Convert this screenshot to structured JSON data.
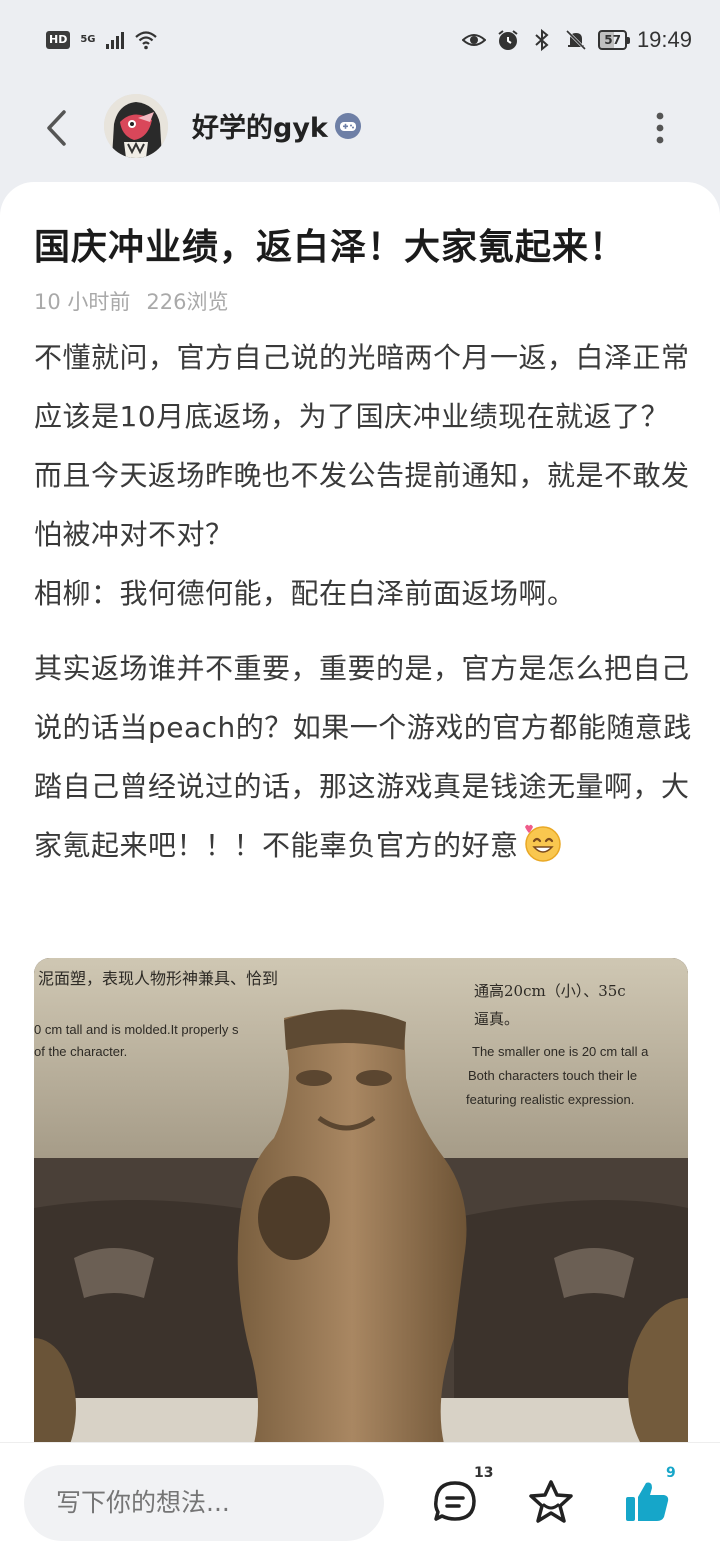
{
  "status_bar": {
    "hd": "HD",
    "network": "5G",
    "battery": "57",
    "time": "19:49"
  },
  "header": {
    "username": "好学的gyk"
  },
  "post": {
    "title": "国庆冲业绩，返白泽！大家氪起来！",
    "time_ago": "10 小时前",
    "views": "226浏览",
    "paragraph_1": "不懂就问，官方自己说的光暗两个月一返，白泽正常应该是10月底返场，为了国庆冲业绩现在就返了？而且今天返场昨晚也不发公告提前通知，就是不敢发怕被冲对不对？",
    "paragraph_2": "相柳：我何德何能，配在白泽前面返场啊。",
    "paragraph_3": "其实返场谁并不重要，重要的是，官方是怎么把自己说的话当peach的？如果一个游戏的官方都能随意践踏自己曾经说过的话，那这游戏真是钱途无量啊，大家氪起来吧！！！不能辜负官方的好意"
  },
  "image": {
    "sign_cn_left": "泥面塑，表现人物形神兼具、恰到",
    "sign_en_left_1": "0 cm tall and is molded.It properly s",
    "sign_en_left_2": "of the character.",
    "sign_cn_right_1": "通高20cm（小）、35c",
    "sign_cn_right_2": "逼真。",
    "sign_en_right_1": "The smaller one is 20 cm tall a",
    "sign_en_right_2": "Both characters touch their le",
    "sign_en_right_3": "featuring realistic expression."
  },
  "bottom_bar": {
    "input_placeholder": "写下你的想法...",
    "comment_count": "13",
    "like_count": "9"
  },
  "colors": {
    "accent": "#16a6c9",
    "background": "#eceef2",
    "card": "#ffffff"
  },
  "icons": [
    "back-arrow-icon",
    "more-dots-icon",
    "game-badge-icon",
    "comment-icon",
    "star-icon",
    "thumbs-up-icon",
    "eye-icon",
    "alarm-icon",
    "bluetooth-icon",
    "bell-off-icon",
    "wifi-icon"
  ]
}
